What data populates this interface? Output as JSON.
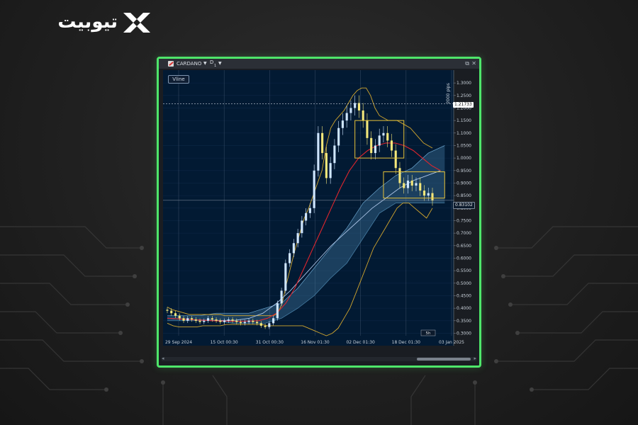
{
  "brand": {
    "logo_text": "تیوبیت",
    "logo_icon": "x-mark-icon"
  },
  "window": {
    "symbol": "CARDANO",
    "timeframe": "D",
    "timeframe_sub": "1",
    "vline_label": "Vline"
  },
  "colors": {
    "frame": "#4ee66a",
    "plot_bg": "#021a33",
    "bollinger": "#d3a72e",
    "ma_fast": "#e0262e",
    "ma_slow": "#aec6e8",
    "cloud": "#4a86b0",
    "candle_up": "#cfe6ff",
    "candle_down": "#f4e77a",
    "box": "#e6c23a"
  },
  "chart_data": {
    "type": "candlestick",
    "symbol": "CARDANO",
    "timeframe": "D1",
    "x_ticks": [
      "29 Sep 2024",
      "15 Oct 00:30",
      "31 Oct 00:30",
      "16 Nov 01:30",
      "02 Dec 01:30",
      "18 Dec 01:30",
      "03 Jan 2025"
    ],
    "y_ticks": [
      "1.3000",
      "1.2500",
      "1.2000",
      "1.1500",
      "1.1000",
      "1.0500",
      "1.0000",
      "0.9500",
      "0.9000",
      "0.8500",
      "0.8000",
      "0.7500",
      "0.7000",
      "0.6500",
      "0.6000",
      "0.5500",
      "0.5000",
      "0.4500",
      "0.4000",
      "0.3500",
      "0.3000"
    ],
    "ylim": [
      0.29,
      1.34
    ],
    "last_price": "0.83102",
    "level_price": "1.21733",
    "pips_label": "2000 pips",
    "bar_counter": "5h",
    "close": [
      0.39,
      0.38,
      0.37,
      0.36,
      0.35,
      0.36,
      0.355,
      0.35,
      0.345,
      0.35,
      0.36,
      0.355,
      0.35,
      0.345,
      0.35,
      0.355,
      0.35,
      0.345,
      0.34,
      0.345,
      0.35,
      0.345,
      0.34,
      0.33,
      0.325,
      0.34,
      0.36,
      0.42,
      0.47,
      0.58,
      0.62,
      0.66,
      0.7,
      0.75,
      0.78,
      0.8,
      0.95,
      1.1,
      1.02,
      0.92,
      0.98,
      1.05,
      1.12,
      1.15,
      1.18,
      1.2,
      1.22,
      1.19,
      1.15,
      1.08,
      1.02,
      1.05,
      1.09,
      1.1,
      1.07,
      1.03,
      0.96,
      0.9,
      0.88,
      0.91,
      0.89,
      0.9,
      0.87,
      0.85,
      0.86,
      0.83
    ],
    "bollinger_upper": [
      0.405,
      0.395,
      0.39,
      0.385,
      0.38,
      0.375,
      0.375,
      0.375,
      0.375,
      0.375,
      0.375,
      0.375,
      0.375,
      0.37,
      0.37,
      0.37,
      0.37,
      0.37,
      0.37,
      0.37,
      0.37,
      0.37,
      0.37,
      0.37,
      0.37,
      0.38,
      0.42,
      0.5,
      0.57,
      0.64,
      0.7,
      0.76,
      0.8,
      0.85,
      0.9,
      0.95,
      1.05,
      1.12,
      1.15,
      1.17,
      1.19,
      1.22,
      1.25,
      1.27,
      1.28,
      1.28,
      1.25,
      1.2,
      1.17,
      1.16,
      1.15,
      1.15,
      1.15,
      1.14,
      1.13,
      1.12,
      1.1,
      1.08,
      1.06,
      1.05,
      1.04
    ],
    "bollinger_lower": [
      0.34,
      0.33,
      0.325,
      0.325,
      0.325,
      0.325,
      0.33,
      0.33,
      0.33,
      0.33,
      0.335,
      0.335,
      0.335,
      0.335,
      0.335,
      0.335,
      0.335,
      0.33,
      0.33,
      0.33,
      0.33,
      0.33,
      0.33,
      0.33,
      0.32,
      0.31,
      0.3,
      0.29,
      0.3,
      0.32,
      0.36,
      0.4,
      0.46,
      0.52,
      0.58,
      0.64,
      0.68,
      0.72,
      0.76,
      0.8,
      0.82,
      0.82,
      0.8,
      0.78,
      0.76,
      0.8
    ],
    "ma_fast": [
      0.36,
      0.358,
      0.356,
      0.354,
      0.352,
      0.35,
      0.349,
      0.348,
      0.348,
      0.349,
      0.35,
      0.36,
      0.38,
      0.42,
      0.48,
      0.56,
      0.64,
      0.72,
      0.8,
      0.88,
      0.95,
      1.0,
      1.03,
      1.05,
      1.06,
      1.06,
      1.05,
      1.03,
      1.0,
      0.97,
      0.95
    ],
    "ma_slow": [
      0.36,
      0.357,
      0.354,
      0.352,
      0.351,
      0.352,
      0.36,
      0.38,
      0.42,
      0.47,
      0.53,
      0.59,
      0.65,
      0.7,
      0.75,
      0.8,
      0.84,
      0.88,
      0.91,
      0.93,
      0.95
    ],
    "cloud_upper": [
      0.37,
      0.37,
      0.37,
      0.38,
      0.38,
      0.38,
      0.4,
      0.42,
      0.48,
      0.56,
      0.64,
      0.72,
      0.82,
      0.88,
      0.93,
      0.96,
      1.02,
      1.05
    ],
    "cloud_lower": [
      0.35,
      0.35,
      0.35,
      0.35,
      0.34,
      0.34,
      0.34,
      0.36,
      0.4,
      0.45,
      0.52,
      0.58,
      0.68,
      0.78,
      0.82,
      0.82,
      0.82,
      0.82
    ],
    "boxes": [
      {
        "label": "box-top",
        "y": [
          1.0,
          1.15
        ]
      },
      {
        "label": "box-bottom",
        "y": [
          0.84,
          0.945
        ]
      }
    ],
    "grid": true
  }
}
